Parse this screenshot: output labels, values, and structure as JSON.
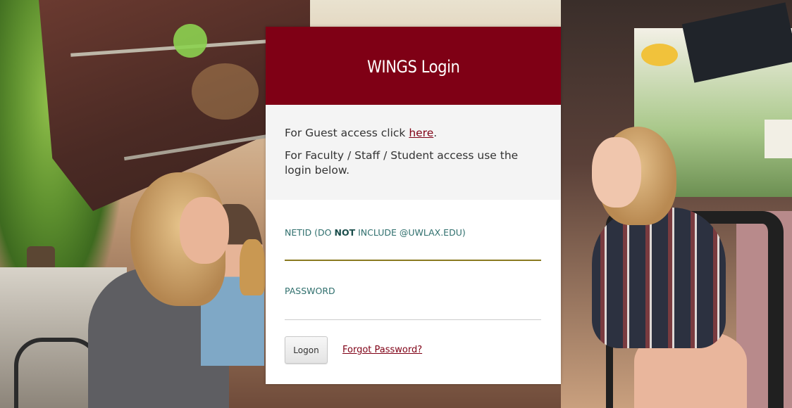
{
  "page": {
    "accent_color": "#7f0015",
    "label_color": "#2f6f6d",
    "background": "campus-ice-cream-shop-photo"
  },
  "login": {
    "title": "WINGS Login",
    "guest_prefix": "For Guest access click ",
    "guest_link": "here",
    "guest_suffix": ".",
    "staff_text": "For Faculty / Staff / Student access use the login below.",
    "netid_label_prefix": "NETID (DO ",
    "netid_label_bold": "NOT",
    "netid_label_suffix": " INCLUDE @UWLAX.EDU)",
    "netid_value": "",
    "password_label": "PASSWORD",
    "password_value": "",
    "logon_button": "Logon",
    "forgot_password": "Forgot Password?"
  }
}
